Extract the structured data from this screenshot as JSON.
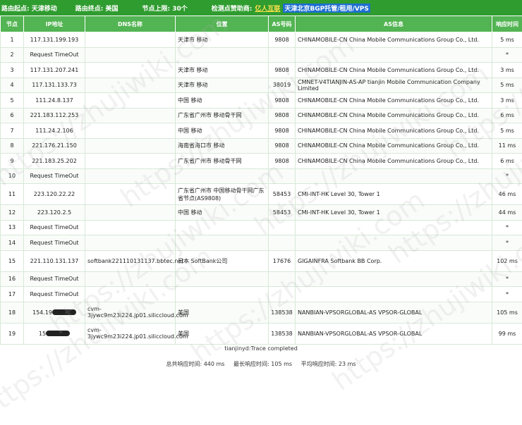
{
  "topbar": {
    "start_label": "路由起点: 天津移动",
    "end_label": "路由终点: 美国",
    "limit_label": "节点上限: 30个",
    "sponsor_prefix": "检测点赞助商:",
    "sponsor_name": "亿人互联",
    "sponsor_desc": "天津北京BGP托管/租用/VPS"
  },
  "columns": [
    "节点",
    "IP地址",
    "DNS名称",
    "位置",
    "AS号码",
    "AS信息",
    "响应时间"
  ],
  "rows": [
    {
      "n": "1",
      "ip": "117.131.199.193",
      "dns": "",
      "loc": "天津市 移动",
      "as": "9808",
      "info": "CHINAMOBILE-CN China Mobile Communications Group Co., Ltd.",
      "t": "5 ms"
    },
    {
      "n": "2",
      "ip": "Request TimeOut",
      "dns": "",
      "loc": "",
      "as": "",
      "info": "",
      "t": "*"
    },
    {
      "n": "3",
      "ip": "117.131.207.241",
      "dns": "",
      "loc": "天津市 移动",
      "as": "9808",
      "info": "CHINAMOBILE-CN China Mobile Communications Group Co., Ltd.",
      "t": "3 ms"
    },
    {
      "n": "4",
      "ip": "117.131.133.73",
      "dns": "",
      "loc": "天津市 移动",
      "as": "38019",
      "info": "CMNET-V4TIANJIN-AS-AP tianjin Mobile Communication Company Limited",
      "t": "5 ms"
    },
    {
      "n": "5",
      "ip": "111.24.8.137",
      "dns": "",
      "loc": "中国 移动",
      "as": "9808",
      "info": "CHINAMOBILE-CN China Mobile Communications Group Co., Ltd.",
      "t": "3 ms"
    },
    {
      "n": "6",
      "ip": "221.183.112.253",
      "dns": "",
      "loc": "广东省广州市 移动骨干网",
      "as": "9808",
      "info": "CHINAMOBILE-CN China Mobile Communications Group Co., Ltd.",
      "t": "6 ms"
    },
    {
      "n": "7",
      "ip": "111.24.2.106",
      "dns": "",
      "loc": "中国 移动",
      "as": "9808",
      "info": "CHINAMOBILE-CN China Mobile Communications Group Co., Ltd.",
      "t": "5 ms"
    },
    {
      "n": "8",
      "ip": "221.176.21.150",
      "dns": "",
      "loc": "海南省海口市 移动",
      "as": "9808",
      "info": "CHINAMOBILE-CN China Mobile Communications Group Co., Ltd.",
      "t": "11 ms"
    },
    {
      "n": "9",
      "ip": "221.183.25.202",
      "dns": "",
      "loc": "广东省广州市 移动骨干网",
      "as": "9808",
      "info": "CHINAMOBILE-CN China Mobile Communications Group Co., Ltd.",
      "t": "6 ms"
    },
    {
      "n": "10",
      "ip": "Request TimeOut",
      "dns": "",
      "loc": "",
      "as": "",
      "info": "",
      "t": "*"
    },
    {
      "n": "11",
      "ip": "223.120.22.22",
      "dns": "",
      "loc": "广东省广州市 中国移动骨干网广东省节点(AS9808)",
      "as": "58453",
      "info": "CMI-INT-HK Level 30, Tower 1",
      "t": "46 ms",
      "tall": true
    },
    {
      "n": "12",
      "ip": "223.120.2.5",
      "dns": "",
      "loc": "中国 移动",
      "as": "58453",
      "info": "CMI-INT-HK Level 30, Tower 1",
      "t": "44 ms"
    },
    {
      "n": "13",
      "ip": "Request TimeOut",
      "dns": "",
      "loc": "",
      "as": "",
      "info": "",
      "t": "*"
    },
    {
      "n": "14",
      "ip": "Request TimeOut",
      "dns": "",
      "loc": "",
      "as": "",
      "info": "",
      "t": "*"
    },
    {
      "n": "15",
      "ip": "221.110.131.137",
      "dns": "softbank221110131137.bbtec.net",
      "loc": "日本 SoftBank公司",
      "as": "17676",
      "info": "GIGAINFRA Softbank BB Corp.",
      "t": "102 ms",
      "tall": true
    },
    {
      "n": "16",
      "ip": "Request TimeOut",
      "dns": "",
      "loc": "",
      "as": "",
      "info": "",
      "t": "*"
    },
    {
      "n": "17",
      "ip": "Request TimeOut",
      "dns": "",
      "loc": "",
      "as": "",
      "info": "",
      "t": "*"
    },
    {
      "n": "18",
      "ip": "154.19",
      "dns": "cvm-3jywc9m23i224.jp01.siliccloud.com",
      "loc": "美国",
      "as": "138538",
      "info": "NANBIAN-VPSORGLOBAL-AS VPSOR-GLOBAL",
      "t": "105 ms",
      "tall": true,
      "redacted": true
    },
    {
      "n": "19",
      "ip": "15",
      "dns": "cvm-3jywc9m23i224.jp01.siliccloud.com",
      "loc": "美国",
      "as": "138538",
      "info": "NANBIAN-VPSORGLOBAL-AS VPSOR-GLOBAL",
      "t": "99 ms",
      "tall": true,
      "redacted": true
    }
  ],
  "footer": {
    "trace_status": "tianjinyd:Trace completed",
    "total_label": "总共响应时间:",
    "total_value": "440 ms",
    "max_label": "最长响应时间:",
    "max_value": "105 ms",
    "avg_label": "平均响应时间:",
    "avg_value": "23 ms"
  },
  "watermark": "https://zhujiwiki.com"
}
